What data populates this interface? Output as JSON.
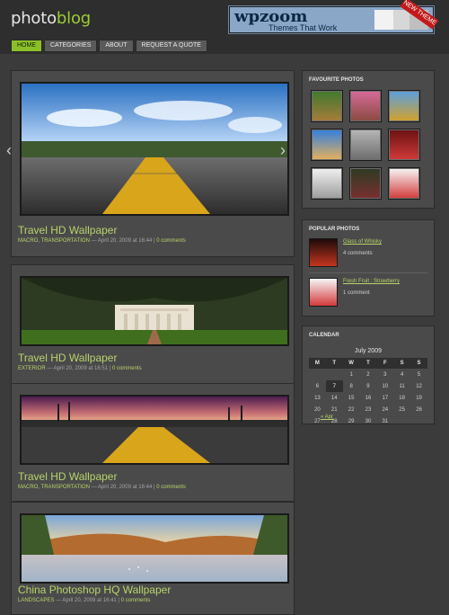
{
  "header": {
    "logo_text_1": "photo",
    "logo_text_2": "blog",
    "banner_title": "wpzoom",
    "banner_sub": "Themes That Work",
    "banner_ribbon": "NEW THEME"
  },
  "nav": {
    "items": [
      {
        "label": "HOME",
        "active": true
      },
      {
        "label": "CATEGORIES",
        "active": false
      },
      {
        "label": "ABOUT",
        "active": false
      },
      {
        "label": "REQUEST A QUOTE",
        "active": false
      }
    ]
  },
  "posts": [
    {
      "title": "Travel HD Wallpaper",
      "cat": "MACRO, TRANSPORTATION",
      "date": "— April 20, 2009 at 16:44 |",
      "comments": "0 comments"
    },
    {
      "title": "Travel HD Wallpaper",
      "cat": "EXTERIOR",
      "date": "— April 20, 2009 at 16:51 |",
      "comments": "0 comments"
    },
    {
      "title": "Travel HD Wallpaper",
      "cat": "MACRO, TRANSPORTATION",
      "date": "— April 20, 2009 at 16:44 |",
      "comments": "0 comments"
    },
    {
      "title": "China Photoshop HQ Wallpaper",
      "cat": "LANDSCAPES",
      "date": "— April 20, 2009 at 16:41 |",
      "comments": "0 comments"
    }
  ],
  "arrows": {
    "left": "‹",
    "right": "›"
  },
  "sidebar": {
    "favourites_title": "FAVOURITE PHOTOS",
    "popular_title": "POPULAR PHOTOS",
    "popular": [
      {
        "name": "Glass of Whisky",
        "count": "4 comments"
      },
      {
        "name": "Fresh Fruit : Strawberry",
        "count": "1 comment"
      }
    ],
    "calendar_title": "CALENDAR",
    "calendar": {
      "month": "July 2009",
      "headers": [
        "M",
        "T",
        "W",
        "T",
        "F",
        "S",
        "S"
      ],
      "weeks": [
        [
          "",
          "",
          "1",
          "2",
          "3",
          "4",
          "5"
        ],
        [
          "6",
          "7",
          "8",
          "9",
          "10",
          "11",
          "12"
        ],
        [
          "13",
          "14",
          "15",
          "16",
          "17",
          "18",
          "19"
        ],
        [
          "20",
          "21",
          "22",
          "23",
          "24",
          "25",
          "26"
        ],
        [
          "27",
          "28",
          "29",
          "30",
          "31",
          "",
          ""
        ]
      ],
      "today": "7",
      "prev": "« Apr"
    }
  },
  "colors": {
    "accent": "#b7d36a",
    "nav_active": "#8bbf2a",
    "bg": "#3b3b3b",
    "panel": "#4a4a4a"
  },
  "icons": {
    "left_arrow": "chevron-left-icon",
    "right_arrow": "chevron-right-icon"
  }
}
